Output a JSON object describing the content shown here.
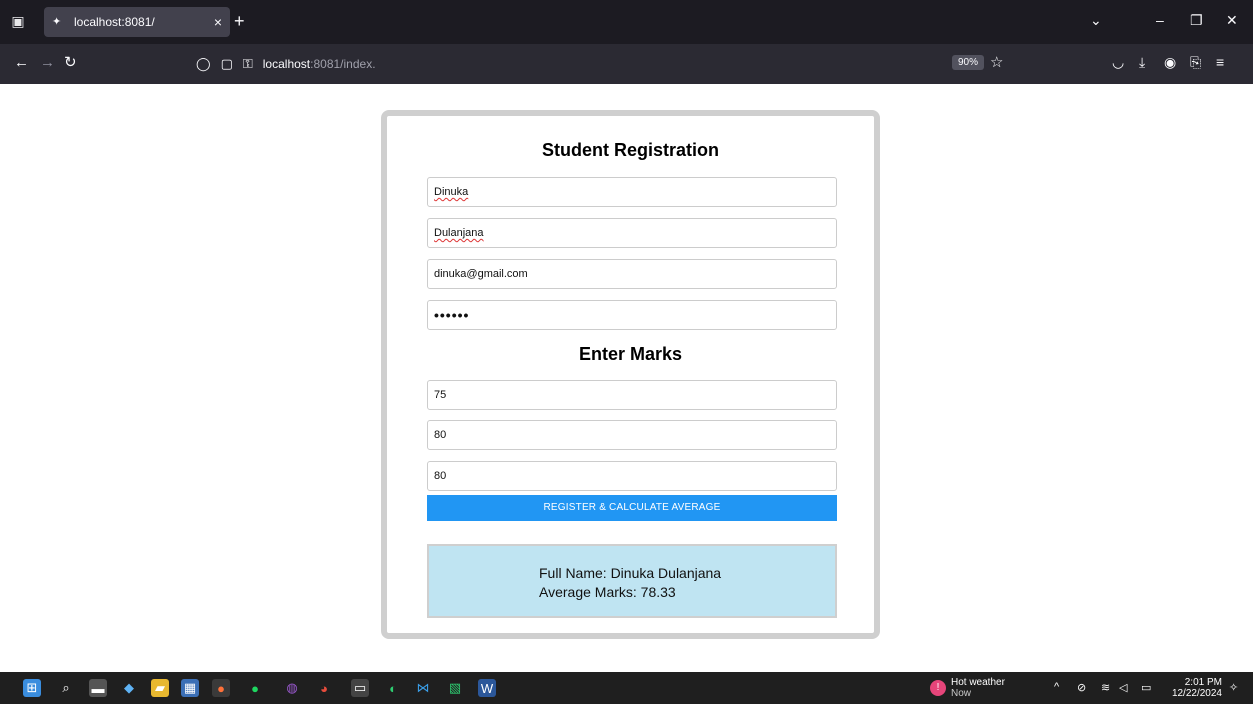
{
  "browser": {
    "tab_title": "localhost:8081/",
    "tab_close": "×",
    "new_tab": "+",
    "url_host": "localhost",
    "url_rest": ":8081/index.",
    "zoom": "90%"
  },
  "form": {
    "title": "Student Registration",
    "first_name": "Dinuka",
    "last_name": "Dulanjana",
    "email": "dinuka@gmail.com",
    "password_mask": "••••••",
    "marks_title": "Enter Marks",
    "mark1": "75",
    "mark2": "80",
    "mark3": "80",
    "submit_label": "REGISTER & CALCULATE AVERAGE"
  },
  "result": {
    "full_name_line": "Full Name: Dinuka Dulanjana",
    "average_line": "Average Marks: 78.33"
  },
  "taskbar": {
    "weather_title": "Hot weather",
    "weather_sub": "Now",
    "time": "2:01 PM",
    "date": "12/22/2024"
  },
  "colors": {
    "accent": "#2196f3",
    "result_bg": "#bfe4f2",
    "browser_dark": "#1c1b22"
  }
}
